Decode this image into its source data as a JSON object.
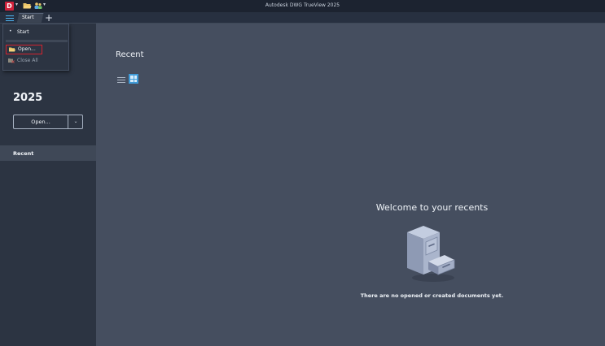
{
  "titlebar": {
    "app_logo_letter": "D",
    "title": "Autodesk DWG TrueView 2025",
    "quick_access": [
      "folder-open-icon",
      "users-icon"
    ]
  },
  "tabs": {
    "items": [
      {
        "label": "Start",
        "active": true
      }
    ],
    "add_label": "+"
  },
  "app_menu": {
    "items": [
      {
        "label": "Start",
        "icon": "bullet-icon",
        "enabled": true
      },
      {
        "label": "Open...",
        "icon": "folder-open-icon",
        "enabled": true,
        "highlighted": true
      },
      {
        "label": "Close All",
        "icon": "close-all-icon",
        "enabled": false
      }
    ]
  },
  "left_panel": {
    "product_year": "2025",
    "open_button": {
      "label": "Open...",
      "dropdown_icon": "chevron-down-icon"
    },
    "nav": [
      {
        "label": "Recent",
        "selected": true
      }
    ]
  },
  "main": {
    "title": "Recent",
    "view_modes": [
      {
        "name": "list-view-icon",
        "selected": false
      },
      {
        "name": "grid-view-icon",
        "selected": true
      }
    ],
    "empty_state": {
      "heading": "Welcome to your recents",
      "message": "There are no opened or created documents yet.",
      "illustration": "file-cabinet-icon"
    }
  },
  "colors": {
    "titlebar_bg": "#1c2330",
    "panel_bg": "#2c3442",
    "main_bg": "#454e5f",
    "accent": "#3f9bd8",
    "logo_red": "#d0213b",
    "highlight_red": "#d3232f"
  }
}
